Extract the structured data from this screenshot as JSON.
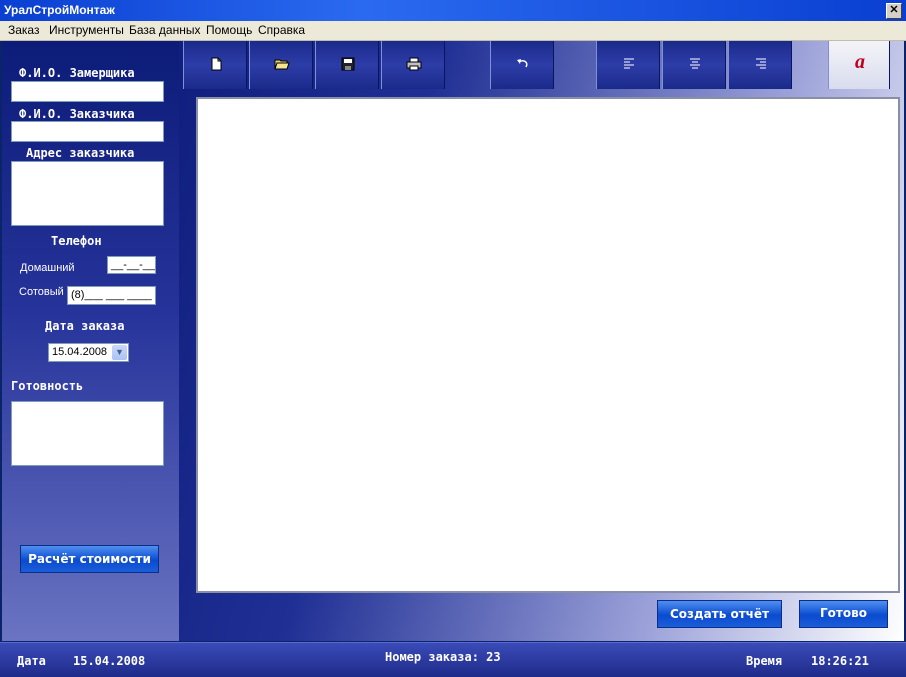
{
  "window": {
    "title": "УралСтройМонтаж",
    "close_glyph": "✕"
  },
  "menu": [
    "Заказ",
    "Инструменты",
    "База данных",
    "Помощь",
    "Справка"
  ],
  "form": {
    "surveyor_label": "Ф.И.О. Замерщика",
    "surveyor_value": "",
    "customer_label": "Ф.И.О. Заказчика",
    "customer_value": "",
    "address_label": "Адрес заказчика",
    "address_value": "",
    "phone_label": "Телефон",
    "home_label": "Домашний",
    "home_value": "__-__-__",
    "mobile_label": "Сотовый",
    "mobile_value": "(8)___ ___ ____",
    "date_label": "Дата заказа",
    "date_value": "15.04.2008",
    "readiness_label": "Готовность",
    "readiness_value": "",
    "calc_button": "Расчёт стоимости"
  },
  "toolbar": {
    "icons": [
      "new-file-icon",
      "open-folder-icon",
      "save-icon",
      "print-icon",
      "undo-icon",
      "align-left-icon",
      "align-center-icon",
      "align-right-icon",
      "font-icon"
    ],
    "font_glyph": "a"
  },
  "editor": {
    "content": ""
  },
  "actions": {
    "report_button": "Создать отчёт",
    "done_button": "Готово"
  },
  "status": {
    "date_label": "Дата",
    "date_value": "15.04.2008",
    "order_label": "Номер заказа: 23",
    "time_label": "Время",
    "time_value": "18:26:21"
  },
  "colors": {
    "accent": "#0a4bd0",
    "panel": "#1f2f94",
    "titlebar": "#0a3fd1"
  }
}
